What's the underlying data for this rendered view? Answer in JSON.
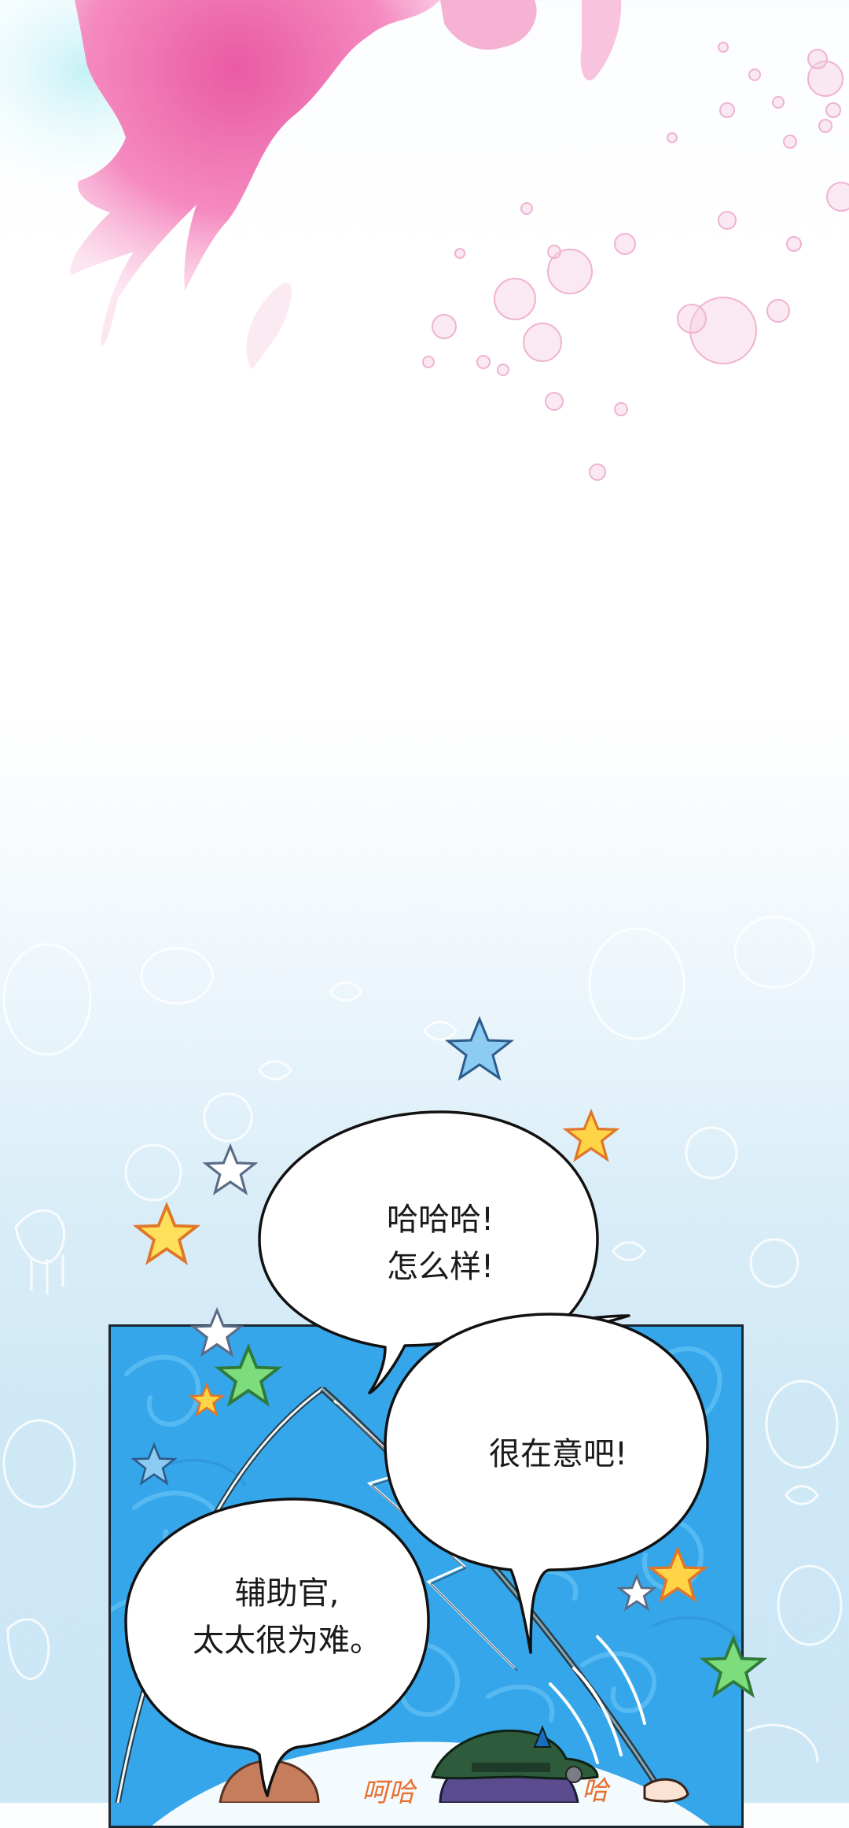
{
  "colors": {
    "splash_pink": "#f07cb2",
    "bubble_pink": "#f2c6de",
    "panel_blue": "#36a6ea",
    "sky_blue": "#cbe6f5",
    "sfx_orange": "#e8702f"
  },
  "icons": {
    "star_shape": "star-icon",
    "bubble_shape": "bubble-icon"
  },
  "speech": {
    "bubble_1": {
      "line1": "哈哈哈!",
      "line2": "怎么样!"
    },
    "bubble_2": {
      "line1": "很在意吧!"
    },
    "bubble_3": {
      "line1": "辅助官,",
      "line2": "太太很为难。"
    }
  },
  "sfx": {
    "left": "呵哈",
    "right": "哈"
  }
}
